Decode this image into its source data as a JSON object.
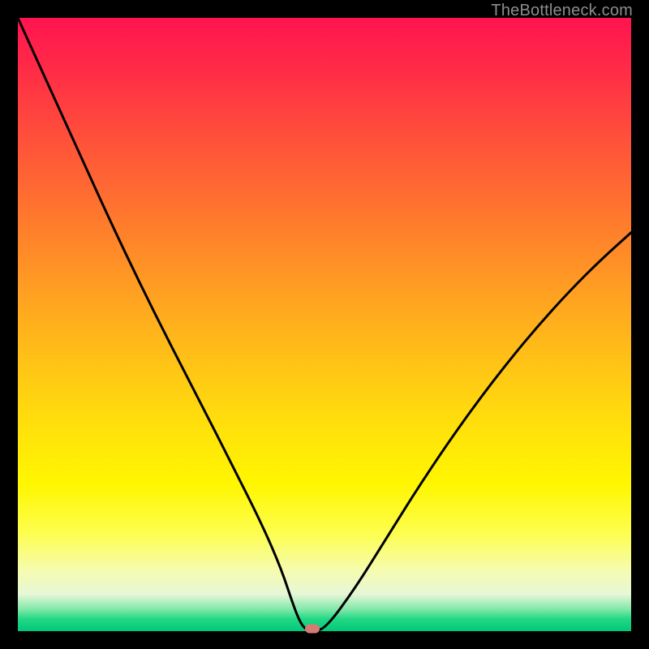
{
  "watermark": "TheBottleneck.com",
  "chart_data": {
    "type": "line",
    "title": "",
    "xlabel": "",
    "ylabel": "",
    "xlim": [
      0,
      100
    ],
    "ylim": [
      0,
      100
    ],
    "series": [
      {
        "name": "bottleneck-curve",
        "x": [
          0,
          5,
          10,
          15,
          20,
          25,
          30,
          35,
          40,
          43,
          45,
          46,
          47,
          48,
          50,
          55,
          60,
          65,
          70,
          75,
          80,
          85,
          90,
          95,
          100
        ],
        "values": [
          100,
          89,
          78,
          67,
          56.5,
          46.5,
          36.8,
          27,
          17,
          10,
          4,
          1.5,
          0.2,
          0.2,
          0.2,
          7,
          15,
          23,
          30.5,
          37.5,
          44,
          50,
          55.5,
          60.5,
          65
        ]
      }
    ],
    "marker": {
      "x": 48,
      "y": 0.4
    },
    "gradient_stops": [
      {
        "pct": 0,
        "color": "#ff1450"
      },
      {
        "pct": 50,
        "color": "#ffb018"
      },
      {
        "pct": 78,
        "color": "#fff600"
      },
      {
        "pct": 100,
        "color": "#00c97a"
      }
    ]
  }
}
